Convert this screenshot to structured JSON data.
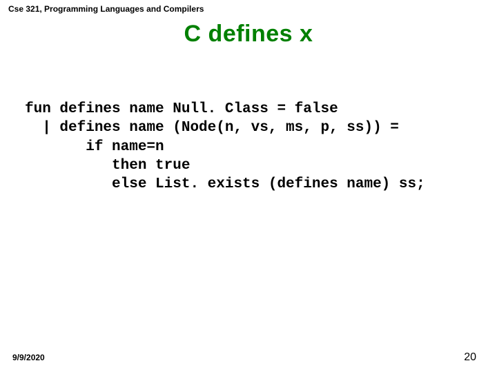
{
  "header": {
    "course": "Cse 321, Programming Languages and Compilers"
  },
  "title": "C defines x",
  "code": {
    "line1": "fun defines name Null. Class = false",
    "line2": "  | defines name (Node(n, vs, ms, p, ss)) =",
    "line3": "       if name=n",
    "line4": "          then true",
    "line5": "          else List. exists (defines name) ss;"
  },
  "footer": {
    "date": "9/9/2020",
    "page": "20"
  }
}
